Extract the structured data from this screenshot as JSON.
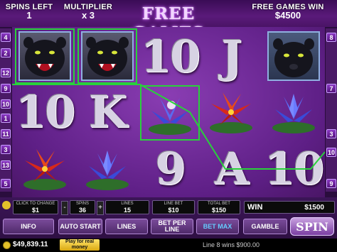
{
  "header": {
    "title": "FREE GAMES",
    "spins_left_label": "SPINS LEFT",
    "spins_left": "1",
    "multiplier_label": "MULTIPLIER",
    "multiplier": "x 3",
    "free_games_win_label": "FREE GAMES WIN",
    "free_games_win": "$4500"
  },
  "paylines_left": [
    "4",
    "2",
    "12",
    "9",
    "10",
    "1",
    "11",
    "3",
    "13",
    "5"
  ],
  "paylines_right": [
    "8",
    "7",
    "3",
    "10",
    "9"
  ],
  "reels": [
    [
      "panther-red",
      "10",
      "flower-red"
    ],
    [
      "panther-red",
      "K",
      "flower-blue"
    ],
    [
      "10",
      "flower-blue",
      "9"
    ],
    [
      "J",
      "flower-red",
      "A"
    ],
    [
      "panther-blue",
      "flower-blue",
      "10"
    ]
  ],
  "controls": {
    "click_to_change_label": "CLICK TO CHANGE",
    "coin_value": "$1",
    "spins_label": "SPINS",
    "spins_value": "36",
    "lines_label": "LINES",
    "lines_value": "15",
    "line_bet_label": "LINE BET",
    "line_bet_value": "$10",
    "total_bet_label": "TOTAL BET",
    "total_bet_value": "$150",
    "win_label": "WIN",
    "win_value": "$1500",
    "minus": "-",
    "plus": "+"
  },
  "buttons": {
    "info": "INFO",
    "auto_start": "AUTO START",
    "lines": "LINES",
    "bet_per_line": "BET PER LINE",
    "bet_max": "BET MAX",
    "gamble": "GAMBLE",
    "spin": "SPIN"
  },
  "status": {
    "balance": "$49,839.11",
    "real_money": "Play for real money",
    "message": "Line 8 wins $900.00"
  },
  "colors": {
    "win_line": "#29d13b",
    "title_glow": "#c44cff",
    "real_money_button": "#ffd43b"
  }
}
